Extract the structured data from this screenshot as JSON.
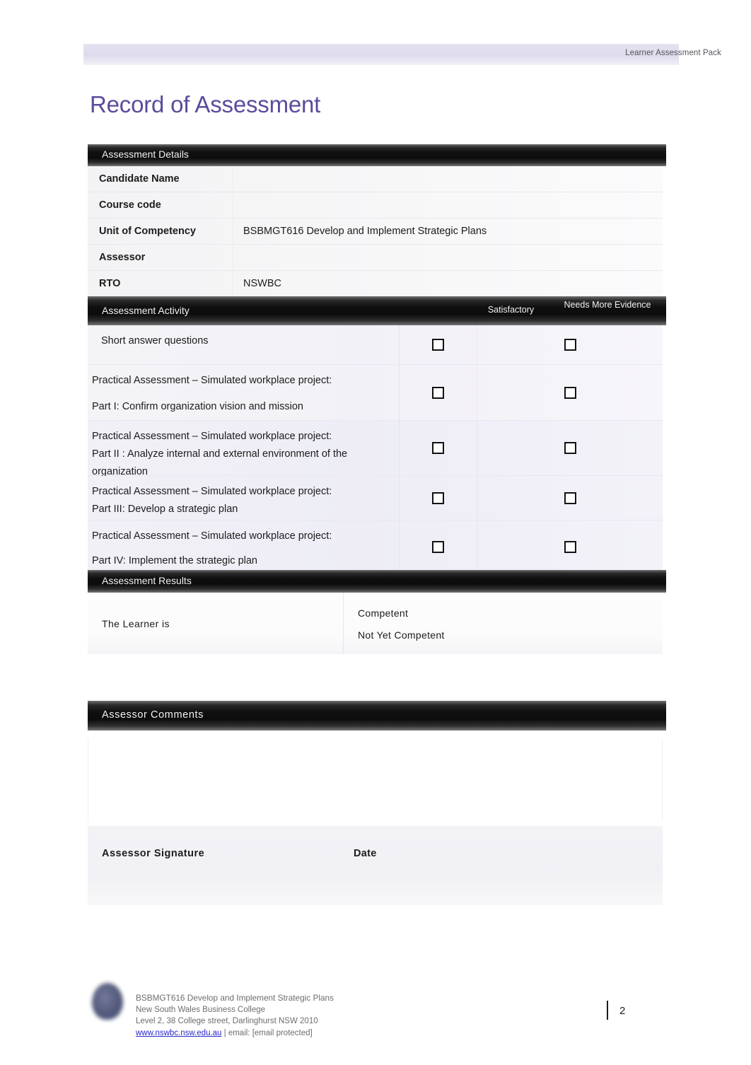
{
  "header": {
    "right_text": "Learner Assessment Pack"
  },
  "title": "Record of Assessment",
  "details": {
    "section_title": "Assessment Details",
    "rows": [
      {
        "label": "Candidate Name",
        "value": ""
      },
      {
        "label": "Course code",
        "value": ""
      },
      {
        "label": "Unit of Competency",
        "value": "BSBMGT616 Develop and Implement Strategic Plans"
      },
      {
        "label": "Assessor",
        "value": ""
      },
      {
        "label": "RTO",
        "value": "NSWBC"
      }
    ]
  },
  "activity": {
    "section_title": "Assessment Activity",
    "col_satisfactory": "Satisfactory",
    "col_needs_more": "Needs More Evidence",
    "rows": [
      {
        "line1": "Short answer questions",
        "line2": ""
      },
      {
        "line1": "Practical Assessment – Simulated workplace project:",
        "line2": "Part I: Confirm organization vision and mission"
      },
      {
        "line1": "Practical Assessment – Simulated workplace project:",
        "line2": "Part II : Analyze internal and external environment of the organization"
      },
      {
        "line1": "Practical Assessment – Simulated workplace project:",
        "line2": "Part III: Develop a strategic plan"
      },
      {
        "line1": "Practical Assessment – Simulated workplace project:",
        "line2": "Part IV: Implement the strategic plan"
      }
    ]
  },
  "results": {
    "section_title": "Assessment Results",
    "learner_label": "The Learner is",
    "option_competent": "Competent",
    "option_not_yet_competent": "Not Yet Competent"
  },
  "comments": {
    "section_title": "Assessor Comments",
    "comment_value": "",
    "signature_label": "Assessor Signature",
    "date_label": "Date"
  },
  "footer": {
    "line1": "BSBMGT616  Develop and Implement Strategic Plans",
    "line2": "New South Wales Business College",
    "line3": "Level 2, 38 College street, Darlinghurst NSW 2010",
    "link": "www.nswbc.nsw.edu.au",
    "line4_rest": " | email: [email protected]",
    "page_number": "2"
  },
  "colors": {
    "title_purple": "#5c4b9c",
    "header_band": "#dedcec",
    "section_bar": "#101010",
    "link_blue": "#2828c8"
  }
}
